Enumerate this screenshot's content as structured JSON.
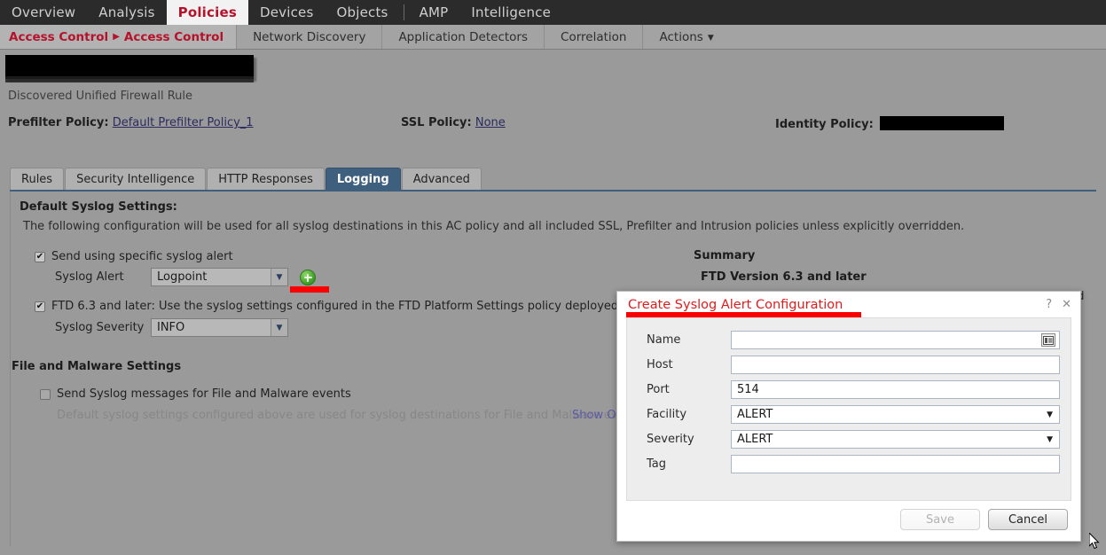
{
  "topnav": {
    "items": [
      {
        "label": "Overview",
        "active": false
      },
      {
        "label": "Analysis",
        "active": false
      },
      {
        "label": "Policies",
        "active": true
      },
      {
        "label": "Devices",
        "active": false
      },
      {
        "label": "Objects",
        "active": false
      },
      {
        "label": "AMP",
        "active": false
      },
      {
        "label": "Intelligence",
        "active": false
      }
    ]
  },
  "subnav": {
    "breadcrumb_parent": "Access Control",
    "breadcrumb_arrow": "▶",
    "breadcrumb_current": "Access Control",
    "items": [
      {
        "label": "Network Discovery"
      },
      {
        "label": "Application Detectors"
      },
      {
        "label": "Correlation"
      },
      {
        "label": "Actions",
        "caret": "▼"
      }
    ]
  },
  "header": {
    "policy_name_redacted": "",
    "subtitle": "Discovered Unified Firewall Rule",
    "prefilter_label": "Prefilter Policy:",
    "prefilter_value": "Default Prefilter Policy_1",
    "ssl_label": "SSL Policy:",
    "ssl_value": "None",
    "identity_label": "Identity Policy:",
    "identity_value_redacted": ""
  },
  "tabs": [
    {
      "label": "Rules",
      "active": false
    },
    {
      "label": "Security Intelligence",
      "active": false
    },
    {
      "label": "HTTP Responses",
      "active": false
    },
    {
      "label": "Logging",
      "active": true
    },
    {
      "label": "Advanced",
      "active": false
    }
  ],
  "logging": {
    "section_title": "Default Syslog Settings:",
    "description": "The following configuration will be used for all syslog destinations in this AC policy and all included SSL, Prefilter and Intrusion policies unless explicitly overridden.",
    "send_specific_alert": {
      "label": "Send using specific syslog alert",
      "checked": true,
      "check_glyph": "✔"
    },
    "syslog_alert": {
      "label": "Syslog Alert",
      "value": "Logpoint",
      "arrow": "▼"
    },
    "add_button_name": "add-syslog-alert",
    "ftd63": {
      "label": "FTD 6.3 and later: Use the syslog settings configured in the FTD Platform Settings policy deployed on the device",
      "checked": true,
      "check_glyph": "✔"
    },
    "syslog_severity": {
      "label": "Syslog Severity",
      "value": "INFO",
      "arrow": "▼"
    },
    "file_malware": {
      "section_title": "File and Malware Settings",
      "checkbox_label": "Send Syslog messages for File and Malware events",
      "checked": false,
      "note": "Default syslog settings configured above are used for syslog destinations for File and Malware events",
      "link": "Show Ove"
    }
  },
  "summary": {
    "title": "Summary",
    "subtitle": "FTD Version 6.3 and later",
    "body_fragment": "ned"
  },
  "modal": {
    "title": "Create Syslog Alert Configuration",
    "help_glyph": "?",
    "close_glyph": "✕",
    "fields": [
      {
        "label": "Name",
        "value": "",
        "type": "text",
        "icon": "address-card-icon"
      },
      {
        "label": "Host",
        "value": "",
        "type": "text"
      },
      {
        "label": "Port",
        "value": "514",
        "type": "text"
      },
      {
        "label": "Facility",
        "value": "ALERT",
        "type": "select",
        "arrow": "▼"
      },
      {
        "label": "Severity",
        "value": "ALERT",
        "type": "select",
        "arrow": "▼"
      },
      {
        "label": "Tag",
        "value": "",
        "type": "text"
      }
    ],
    "save_label": "Save",
    "save_disabled": true,
    "cancel_label": "Cancel"
  },
  "colors": {
    "accent_red": "#b5122b",
    "annotation_red": "#fb0000",
    "modal_title_red": "#e11c1c",
    "active_tab_blue": "#3f5f7f",
    "link_blue": "#2b2b5e"
  }
}
